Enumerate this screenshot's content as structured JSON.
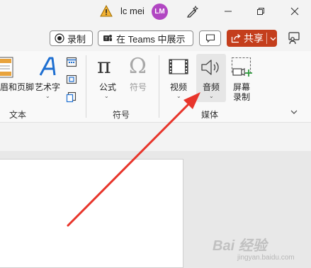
{
  "titlebar": {
    "user_name": "lc mei",
    "avatar_initials": "LM",
    "avatar_color": "#b146c2",
    "icons": [
      "warning-icon",
      "pen-sparkle-icon",
      "minimize-icon",
      "restore-icon",
      "close-icon"
    ]
  },
  "actionbar": {
    "record_label": "录制",
    "teams_label": "在 Teams 中展示",
    "share_label": "共享",
    "share_color": "#c43e1c"
  },
  "ribbon": {
    "text_group": {
      "header_footer_label": "眉和页脚",
      "wordart_label": "艺术字",
      "group_label": "文本"
    },
    "symbol_group": {
      "equation_label": "公式",
      "symbol_label": "符号",
      "group_label": "符号"
    },
    "media_group": {
      "video_label": "视频",
      "audio_label": "音频",
      "screen_record_label_1": "屏幕",
      "screen_record_label_2": "录制",
      "group_label": "媒体"
    }
  },
  "annotation": {
    "arrow_color": "#e8352b"
  },
  "watermark": {
    "text": "Bai 经验",
    "sub": "jingyan.baidu.com"
  }
}
